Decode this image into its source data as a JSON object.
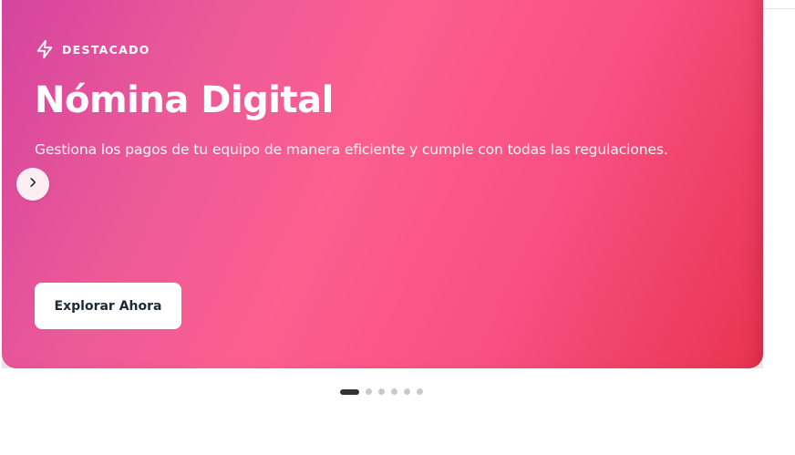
{
  "hero": {
    "badge_label": "DESTACADO",
    "badge_icon": "lightning-icon",
    "title": "Nómina Digital",
    "subtitle": "Gestiona los pagos de tu equipo de manera eficiente y cumple con todas las regulaciones.",
    "cta_label": "Explorar Ahora",
    "next_icon": "chevron-right-icon"
  },
  "pagination": {
    "total": 6,
    "active_index": 0
  },
  "colors": {
    "gradient_start": "#d4449f",
    "gradient_mid": "#fd5f8f",
    "gradient_end": "#e8344f",
    "cta_text": "#1f2937",
    "dot_active": "#333333",
    "dot_inactive": "#c9c9c9"
  }
}
